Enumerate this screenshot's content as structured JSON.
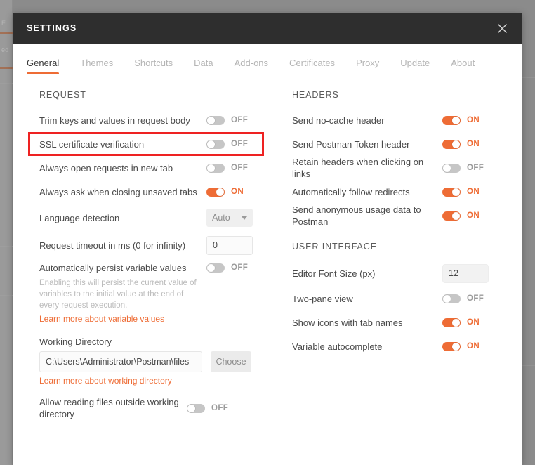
{
  "window": {
    "title": "SETTINGS",
    "close_icon": "close-icon",
    "accent_color": "#ee6c35",
    "header_bg": "#2e2e2e",
    "overlay_color": "#8b8b8b",
    "highlight_color": "#ee2222"
  },
  "tabs": [
    {
      "label": "General",
      "active": true
    },
    {
      "label": "Themes",
      "active": false
    },
    {
      "label": "Shortcuts",
      "active": false
    },
    {
      "label": "Data",
      "active": false
    },
    {
      "label": "Add-ons",
      "active": false
    },
    {
      "label": "Certificates",
      "active": false
    },
    {
      "label": "Proxy",
      "active": false
    },
    {
      "label": "Update",
      "active": false
    },
    {
      "label": "About",
      "active": false
    }
  ],
  "left_column": {
    "section_title": "REQUEST",
    "rows": {
      "trim_keys": {
        "label": "Trim keys and values in request body",
        "state": "OFF"
      },
      "ssl_verification": {
        "label": "SSL certificate verification",
        "state": "OFF"
      },
      "open_new_tab": {
        "label": "Always open requests in new tab",
        "state": "OFF"
      },
      "ask_closing": {
        "label": "Always ask when closing unsaved tabs",
        "state": "ON"
      },
      "language_detection": {
        "label": "Language detection",
        "value": "Auto"
      },
      "request_timeout": {
        "label": "Request timeout in ms (0 for infinity)",
        "value": "0"
      },
      "persist_variables": {
        "label": "Automatically persist variable values",
        "state": "OFF"
      },
      "allow_outside": {
        "label": "Allow reading files outside working directory",
        "state": "OFF"
      }
    },
    "persist_help": "Enabling this will persist the current value of variables to the initial value at the end of every request execution.",
    "persist_link": "Learn more about variable values",
    "working_directory_label": "Working Directory",
    "working_directory_value": "C:\\Users\\Administrator\\Postman\\files",
    "choose_button": "Choose",
    "working_directory_link": "Learn more about working directory"
  },
  "right_column": {
    "headers_title": "HEADERS",
    "headers_rows": {
      "no_cache": {
        "label": "Send no-cache header",
        "state": "ON"
      },
      "postman_token": {
        "label": "Send Postman Token header",
        "state": "ON"
      },
      "retain_headers": {
        "label": "Retain headers when clicking on links",
        "state": "OFF"
      },
      "follow_redirects": {
        "label": "Automatically follow redirects",
        "state": "ON"
      },
      "usage_data": {
        "label": "Send anonymous usage data to Postman",
        "state": "ON"
      }
    },
    "ui_title": "USER INTERFACE",
    "ui_rows": {
      "font_size": {
        "label": "Editor Font Size (px)",
        "value": "12"
      },
      "two_pane": {
        "label": "Two-pane view",
        "state": "OFF"
      },
      "show_icons": {
        "label": "Show icons with tab names",
        "state": "ON"
      },
      "variable_autocomplete": {
        "label": "Variable autocomplete",
        "state": "ON"
      }
    }
  },
  "backdrop": {
    "label_a": "E",
    "label_b": "ed"
  }
}
